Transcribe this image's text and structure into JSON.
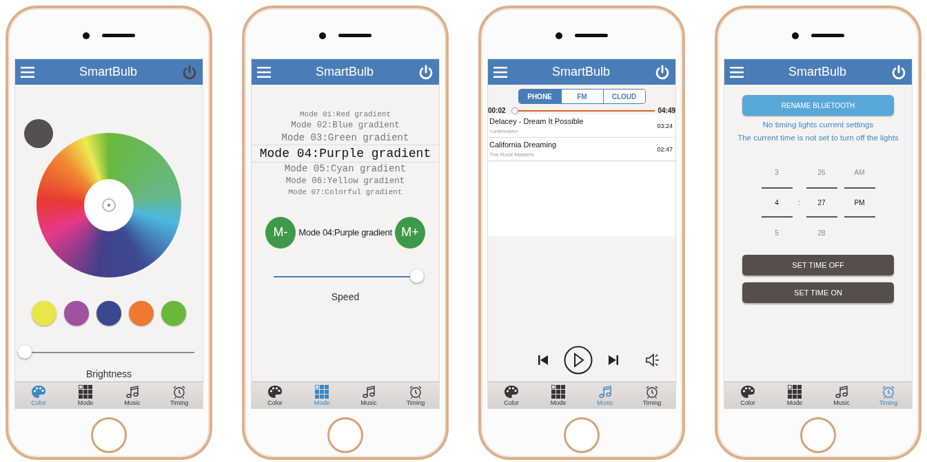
{
  "phones": [
    {
      "kind": "color",
      "title": "SmartBulb",
      "power_on": false,
      "presets": [
        {
          "color": "#e8e64a"
        },
        {
          "color": "#a052a0"
        },
        {
          "color": "#3b4890"
        },
        {
          "color": "#ee7a32"
        },
        {
          "color": "#6ab83a"
        }
      ],
      "brightness": {
        "level": 0.0,
        "label": "Brightness"
      },
      "tabs": [
        {
          "label": "Color",
          "selected": true
        },
        {
          "label": "Mode",
          "selected": false
        },
        {
          "label": "Music",
          "selected": false
        },
        {
          "label": "Timing",
          "selected": false
        }
      ]
    },
    {
      "kind": "mode",
      "title": "SmartBulb",
      "power_on": true,
      "modes": [
        {
          "label": "Mode 01:Red gradient",
          "selected": false
        },
        {
          "label": "Mode 02:Blue gradient",
          "selected": false
        },
        {
          "label": "Mode 03:Green gradient",
          "selected": false
        },
        {
          "label": "Mode 04:Purple gradient",
          "selected": true
        },
        {
          "label": "Mode 05:Cyan gradient",
          "selected": false
        },
        {
          "label": "Mode 06:Yellow gradient",
          "selected": false
        },
        {
          "label": "Mode 07:Colorful gradient",
          "selected": false
        }
      ],
      "prev_button": "M-",
      "current_mode": "Mode 04:Purple gradient",
      "next_button": "M+",
      "speed": {
        "level": 1.0,
        "label": "Speed"
      },
      "tabs": [
        {
          "label": "Color",
          "selected": false
        },
        {
          "label": "Mode",
          "selected": true
        },
        {
          "label": "Music",
          "selected": false
        },
        {
          "label": "Timing",
          "selected": false
        }
      ]
    },
    {
      "kind": "music",
      "title": "SmartBulb",
      "power_on": true,
      "sources": [
        {
          "label": "PHONE",
          "selected": true
        },
        {
          "label": "FM",
          "selected": false
        },
        {
          "label": "CLOUD",
          "selected": false
        }
      ],
      "progress": {
        "elapsed": "00:02",
        "total": "04:49",
        "level": 0.0
      },
      "songs": [
        {
          "title": "Delacey - Dream It Possible",
          "artist": "<unknown>",
          "duration": "03:24"
        },
        {
          "title": "California Dreaming",
          "artist": "The Rock Masters",
          "duration": "02:47"
        }
      ],
      "tabs": [
        {
          "label": "Color",
          "selected": false
        },
        {
          "label": "Mode",
          "selected": false
        },
        {
          "label": "Music",
          "selected": true
        },
        {
          "label": "Timing",
          "selected": false
        }
      ]
    },
    {
      "kind": "timing",
      "title": "SmartBulb",
      "power_on": true,
      "rename_button": "RENAME BLUETOOTH",
      "messages": [
        "No timing lights current settings",
        "The current time is not set to turn off the lights"
      ],
      "picker": {
        "separator": ":",
        "columns": [
          {
            "values": [
              {
                "text": "3",
                "selected": false
              },
              {
                "text": "4",
                "selected": true
              },
              {
                "text": "5",
                "selected": false
              }
            ]
          },
          {
            "values": [
              {
                "text": "26",
                "selected": false
              },
              {
                "text": "27",
                "selected": true
              },
              {
                "text": "28",
                "selected": false
              }
            ]
          },
          {
            "values": [
              {
                "text": "AM",
                "selected": false
              },
              {
                "text": "PM",
                "selected": true
              }
            ]
          }
        ]
      },
      "buttons": [
        "SET TIME OFF",
        "SET TIME ON"
      ],
      "tabs": [
        {
          "label": "Color",
          "selected": false
        },
        {
          "label": "Mode",
          "selected": false
        },
        {
          "label": "Music",
          "selected": false
        },
        {
          "label": "Timing",
          "selected": true
        }
      ]
    }
  ]
}
